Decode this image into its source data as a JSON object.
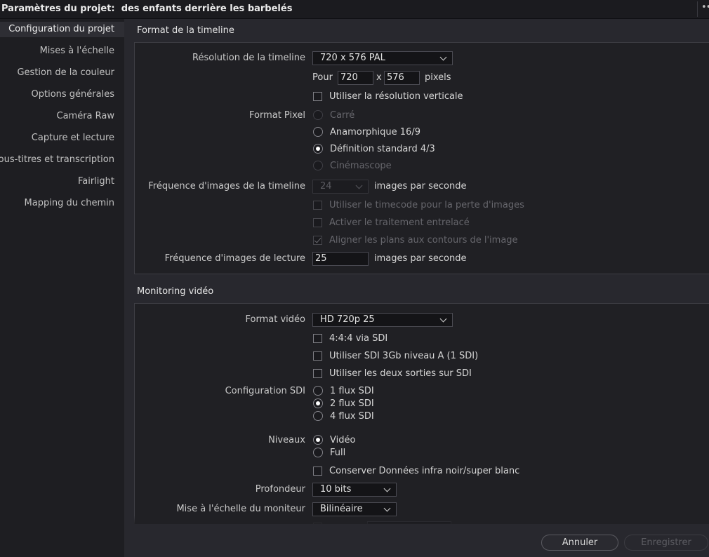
{
  "window": {
    "title_prefix": "Paramètres du projet:",
    "project_name": "des enfants derrière les barbelés",
    "menu_icon": "ellipsis-icon"
  },
  "sidebar": {
    "items": [
      {
        "label": "Configuration du projet",
        "active": true
      },
      {
        "label": "Mises à l'échelle"
      },
      {
        "label": "Gestion de la couleur"
      },
      {
        "label": "Options générales"
      },
      {
        "label": "Caméra Raw"
      },
      {
        "label": "Capture et lecture"
      },
      {
        "label": "Sous-titres et transcription"
      },
      {
        "label": "Fairlight"
      },
      {
        "label": "Mapping du chemin"
      }
    ]
  },
  "timeline_format": {
    "section_title": "Format de la timeline",
    "resolution_label": "Résolution de la timeline",
    "resolution_value": "720 x 576 PAL",
    "pour_label": "Pour",
    "width": "720",
    "x_label": "x",
    "height": "576",
    "pixels_label": "pixels",
    "vertical_res_label": "Utiliser la résolution verticale",
    "pixel_format_label": "Format Pixel",
    "pixel_options": [
      "Carré",
      "Anamorphique 16/9",
      "Définition standard 4/3",
      "Cinémascope"
    ],
    "framerate_label": "Fréquence d'images de la timeline",
    "framerate_value": "24",
    "fps_unit": "images par seconde",
    "dropframe_label": "Utiliser le timecode pour la perte d'images",
    "interlace_label": "Activer le traitement entrelacé",
    "align_label": "Aligner les plans aux contours de l'image",
    "playback_label": "Fréquence d'images de lecture",
    "playback_value": "25",
    "playback_unit": "images par seconde"
  },
  "video_monitoring": {
    "section_title": "Monitoring vidéo",
    "video_format_label": "Format vidéo",
    "video_format_value": "HD 720p 25",
    "sdi444_label": "4:4:4 via SDI",
    "sdi3gb_label": "Utiliser SDI 3Gb niveau A (1 SDI)",
    "dual_out_label": "Utiliser les deux sorties sur SDI",
    "sdi_config_label": "Configuration SDI",
    "sdi_options": [
      "1 flux SDI",
      "2 flux SDI",
      "4 flux SDI"
    ],
    "levels_label": "Niveaux",
    "levels_options": [
      "Vidéo",
      "Full"
    ],
    "retain_label": "Conserver Données infra noir/super blanc",
    "depth_label": "Profondeur",
    "depth_value": "10 bits",
    "scaling_label": "Mise à l'échelle du moniteur",
    "scaling_value": "Bilinéaire"
  },
  "footer": {
    "cancel_label": "Annuler",
    "save_label": "Enregistrer"
  }
}
